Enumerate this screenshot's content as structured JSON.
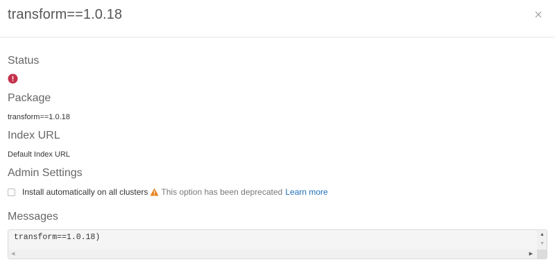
{
  "header": {
    "title": "transform==1.0.18",
    "close_icon": "close-icon"
  },
  "status": {
    "label": "Status",
    "icon": "error-icon",
    "icon_color": "#c4314b"
  },
  "package": {
    "label": "Package",
    "value": "transform==1.0.18"
  },
  "index_url": {
    "label": "Index URL",
    "value": "Default Index URL"
  },
  "admin_settings": {
    "label": "Admin Settings",
    "checkbox_label": "Install automatically on all clusters",
    "checkbox_checked": false,
    "warning_icon": "warning-icon",
    "warning_color": "#e8831e",
    "deprecated_text": "This option has been deprecated",
    "learn_more": "Learn more"
  },
  "messages": {
    "label": "Messages",
    "content": "transform==1.0.18)"
  }
}
